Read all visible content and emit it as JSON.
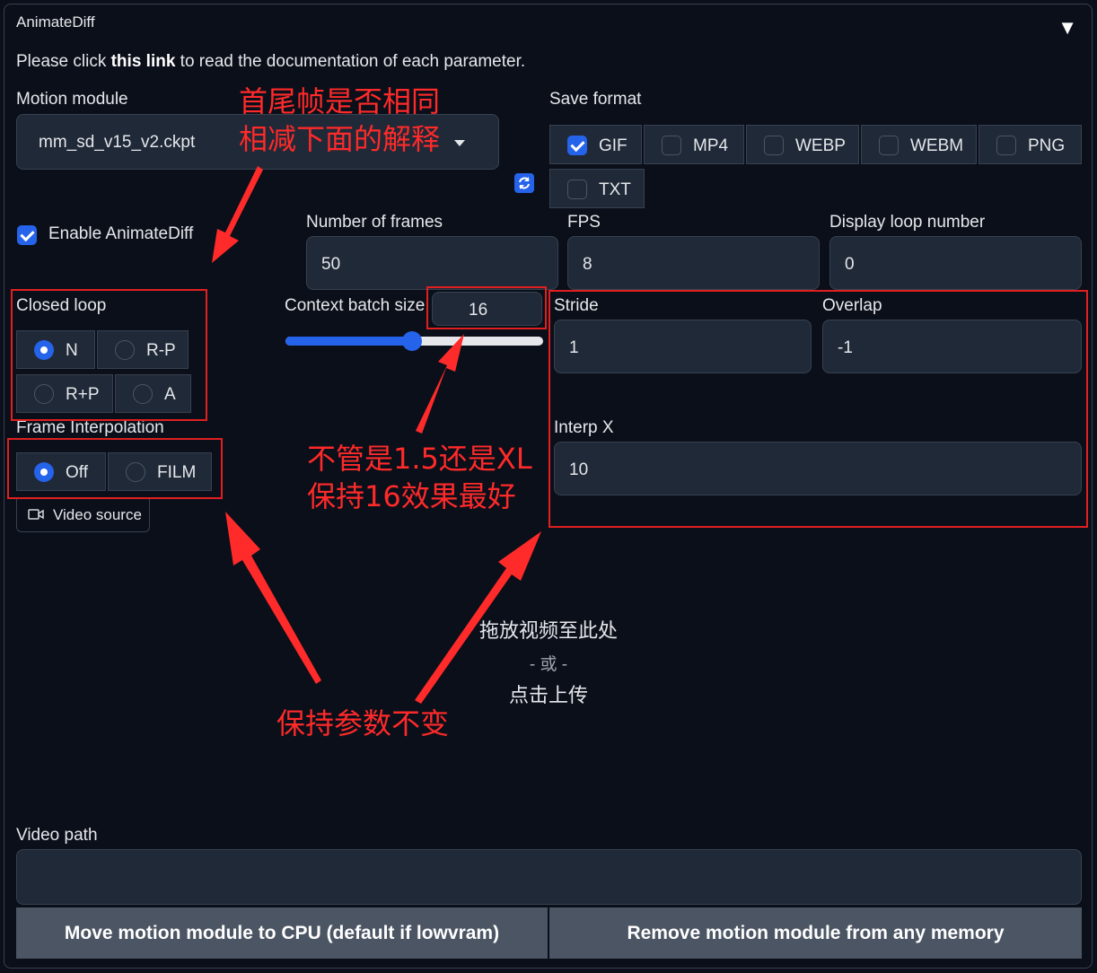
{
  "panel": {
    "title": "AnimateDiff",
    "collapse_icon": "triangle-down-icon"
  },
  "doc": {
    "prefix": "Please click ",
    "link": "this link",
    "suffix": " to read the documentation of each parameter."
  },
  "motion_module": {
    "label": "Motion module",
    "value": "mm_sd_v15_v2.ckpt",
    "refresh_icon": "refresh-icon"
  },
  "save_format": {
    "label": "Save format",
    "options": [
      {
        "label": "GIF",
        "checked": true
      },
      {
        "label": "MP4",
        "checked": false
      },
      {
        "label": "WEBP",
        "checked": false
      },
      {
        "label": "WEBM",
        "checked": false
      },
      {
        "label": "PNG",
        "checked": false
      },
      {
        "label": "TXT",
        "checked": false
      }
    ]
  },
  "enable": {
    "label": "Enable AnimateDiff",
    "checked": true
  },
  "frames": {
    "label": "Number of frames",
    "value": "50"
  },
  "fps": {
    "label": "FPS",
    "value": "8"
  },
  "loop_number": {
    "label": "Display loop number",
    "value": "0"
  },
  "closed_loop": {
    "label": "Closed loop",
    "options": [
      "N",
      "R-P",
      "R+P",
      "A"
    ],
    "selected": "N"
  },
  "context_batch": {
    "label": "Context batch size",
    "value": "16",
    "slider_fraction": 0.49
  },
  "stride": {
    "label": "Stride",
    "value": "1"
  },
  "overlap": {
    "label": "Overlap",
    "value": "-1"
  },
  "interp_x": {
    "label": "Interp X",
    "value": "10"
  },
  "frame_interp": {
    "label": "Frame Interpolation",
    "options": [
      "Off",
      "FILM"
    ],
    "selected": "Off"
  },
  "video_source": {
    "label": "Video source",
    "icon": "video-camera-icon"
  },
  "upload": {
    "line1": "拖放视频至此处",
    "line2": "- 或 -",
    "line3": "点击上传"
  },
  "video_path": {
    "label": "Video path",
    "value": ""
  },
  "buttons": {
    "move_cpu": "Move motion module to CPU (default if lowvram)",
    "remove": "Remove motion module from any memory"
  },
  "annotations": {
    "a1_line1": "首尾帧是否相同",
    "a1_line2": "相减下面的解释",
    "a2_line1": "不管是1.5还是XL",
    "a2_line2": "保持16效果最好",
    "a3": "保持参数不变"
  },
  "colors": {
    "accent": "#2563eb",
    "annotation_red": "#ff2a2a",
    "background": "#0b0f19",
    "field": "#1f2937"
  }
}
